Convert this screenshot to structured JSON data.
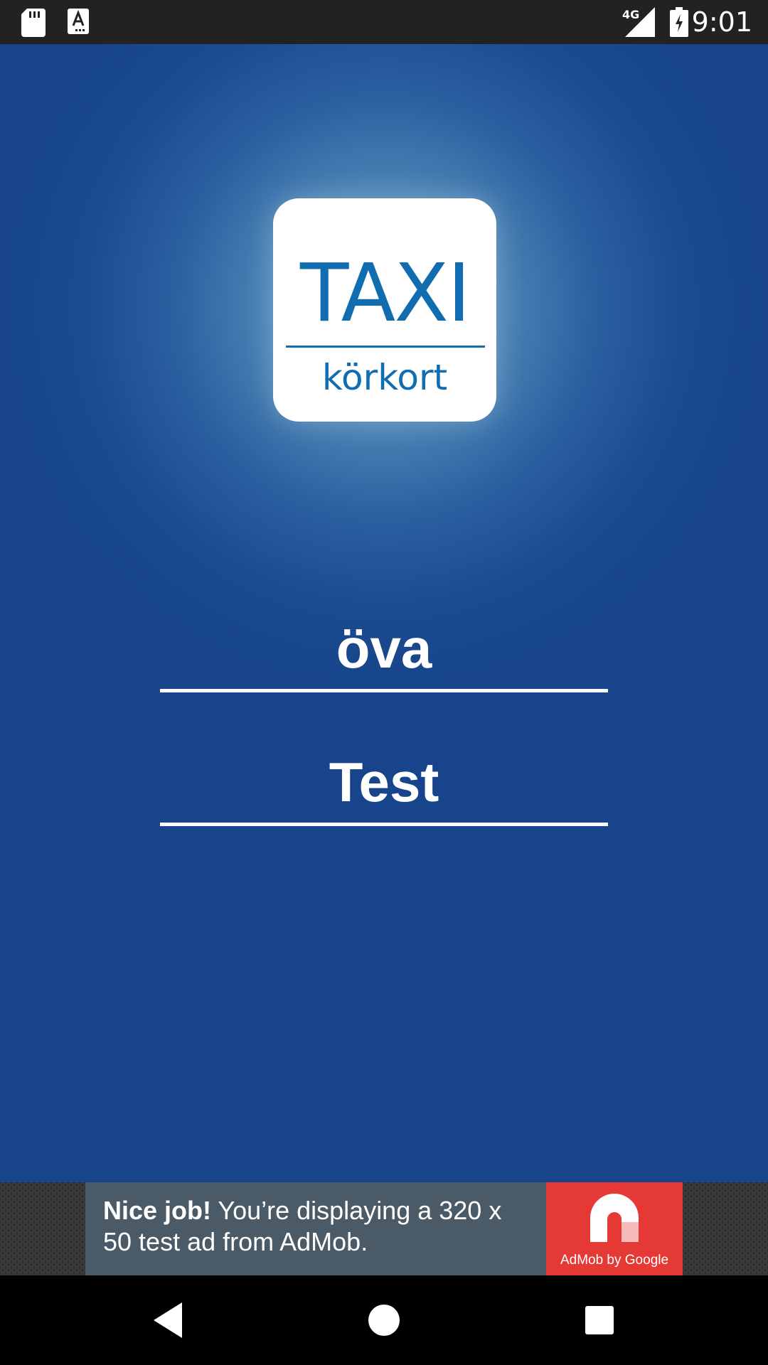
{
  "status_bar": {
    "time": "9:01",
    "network": "4G",
    "icons": [
      "sd-card-icon",
      "text-notification-icon",
      "signal-4g-icon",
      "battery-charging-icon"
    ]
  },
  "logo": {
    "title": "TAXI",
    "subtitle": "körkort",
    "color": "#0f6db0"
  },
  "menu": {
    "practice_label": "öva",
    "test_label": "Test"
  },
  "ad": {
    "headline": "Nice job!",
    "body": " You’re displaying a 320 x 50 test ad from AdMob.",
    "logo_caption": "AdMob by Google",
    "logo_color": "#e53935"
  },
  "nav": {
    "icons": [
      "back-icon",
      "home-icon",
      "recents-icon"
    ]
  },
  "colors": {
    "background": "#17448a",
    "status_bar": "#222222"
  }
}
